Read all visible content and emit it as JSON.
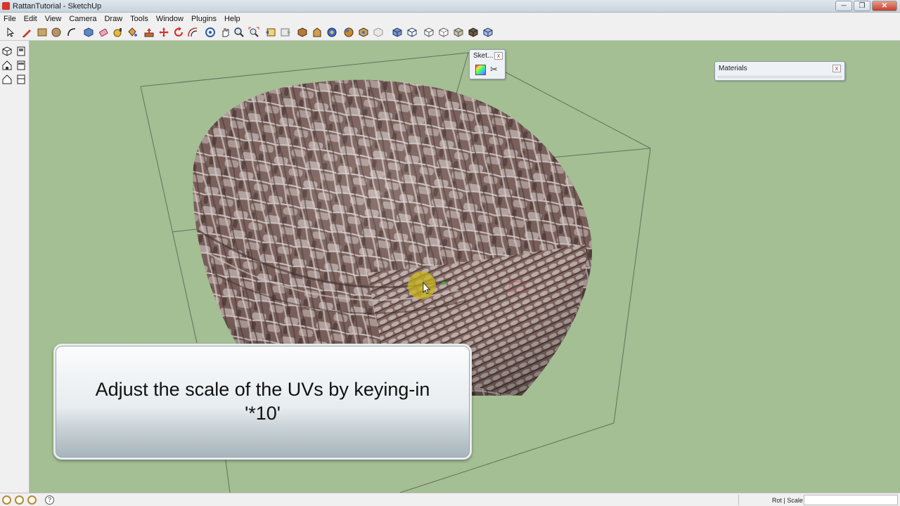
{
  "window": {
    "title": "RattanTutorial - SketchUp",
    "minimize": "─",
    "restore": "❐",
    "close": "✕"
  },
  "menu": [
    "File",
    "Edit",
    "View",
    "Camera",
    "Draw",
    "Tools",
    "Window",
    "Plugins",
    "Help"
  ],
  "toolbar_icons": [
    "select-icon",
    "pencil-icon",
    "rectangle-icon",
    "circle-icon",
    "arc-icon",
    "make-component-icon",
    "eraser-icon",
    "tape-measure-icon",
    "paint-bucket-icon",
    "push-pull-icon",
    "move-icon",
    "rotate-icon",
    "offset-icon",
    "orbit-icon",
    "pan-icon",
    "zoom-icon",
    "zoom-extents-icon",
    "previous-view-icon",
    "next-view-icon",
    "get-models-icon",
    "share-model-icon",
    "share-component-icon",
    "photo-textures-icon",
    "iso-view-icon",
    "top-view-icon",
    "front-view-icon",
    "right-view-icon",
    "back-view-icon",
    "left-view-icon",
    "xray-icon",
    "wireframe-icon",
    "hidden-line-icon",
    "shaded-icon",
    "shaded-textures-icon",
    "monochrome-icon"
  ],
  "palettes": {
    "sketch": {
      "title": "Sket...",
      "close": "x"
    },
    "materials": {
      "title": "Materials",
      "close": "x"
    }
  },
  "caption": {
    "line1": "Adjust the scale of the UVs by keying-in",
    "line2": "'*10'"
  },
  "status": {
    "vcb_label": "Rot | Scale",
    "vcb_value": "",
    "help_icon": "?"
  }
}
